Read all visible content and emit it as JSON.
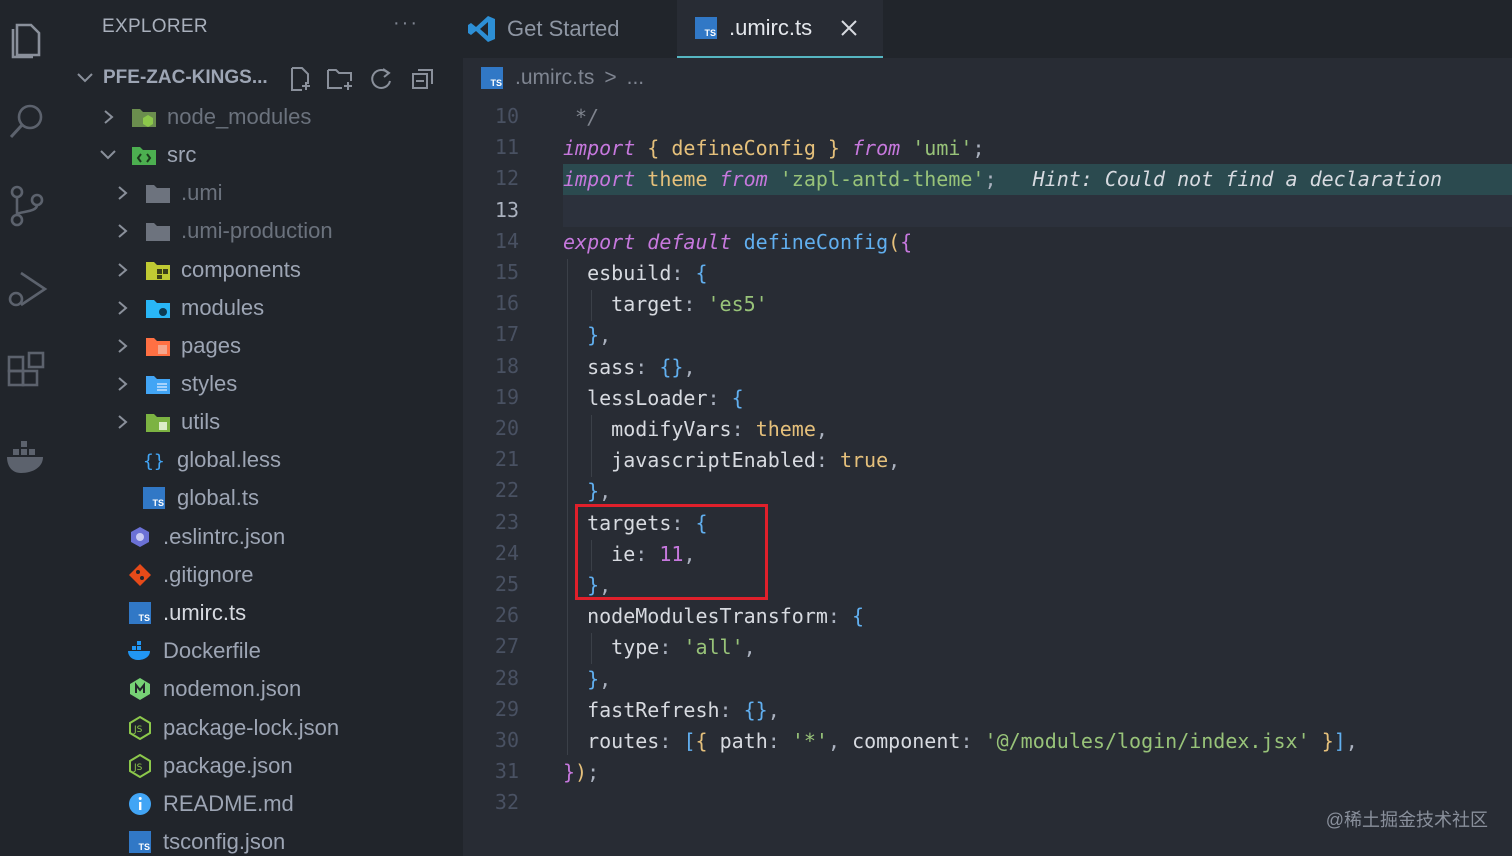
{
  "activity_bar": {
    "icons": [
      "files-icon",
      "search-icon",
      "source-control-icon",
      "run-debug-icon",
      "extensions-icon",
      "docker-icon"
    ]
  },
  "sidebar": {
    "title": "EXPLORER",
    "more": "···",
    "folder_name": "PFE-ZAC-KINGS...",
    "tree": [
      {
        "label": "node_modules",
        "dim": true
      },
      {
        "label": "src",
        "dim": false
      },
      {
        "label": ".umi",
        "dim": true
      },
      {
        "label": ".umi-production",
        "dim": true
      },
      {
        "label": "components",
        "dim": false
      },
      {
        "label": "modules",
        "dim": false
      },
      {
        "label": "pages",
        "dim": false
      },
      {
        "label": "styles",
        "dim": false
      },
      {
        "label": "utils",
        "dim": false
      },
      {
        "label": "global.less",
        "dim": false
      },
      {
        "label": "global.ts",
        "dim": false
      },
      {
        "label": ".eslintrc.json",
        "dim": false
      },
      {
        "label": ".gitignore",
        "dim": false
      },
      {
        "label": ".umirc.ts",
        "dim": false
      },
      {
        "label": "Dockerfile",
        "dim": false
      },
      {
        "label": "nodemon.json",
        "dim": false
      },
      {
        "label": "package-lock.json",
        "dim": false
      },
      {
        "label": "package.json",
        "dim": false
      },
      {
        "label": "README.md",
        "dim": false
      },
      {
        "label": "tsconfig.json",
        "dim": false
      }
    ]
  },
  "tabs": [
    {
      "label": "Get Started",
      "active": false
    },
    {
      "label": ".umirc.ts",
      "active": true
    }
  ],
  "breadcrumb": {
    "file": ".umirc.ts",
    "sep": ">",
    "rest": "..."
  },
  "line_numbers": [
    "10",
    "11",
    "12",
    "13",
    "14",
    "15",
    "16",
    "17",
    "18",
    "19",
    "20",
    "21",
    "22",
    "23",
    "24",
    "25",
    "26",
    "27",
    "28",
    "29",
    "30",
    "31",
    "32"
  ],
  "current_line": "13",
  "code": {
    "l10": " */",
    "l11_import": "import",
    "l11_body": " defineConfig ",
    "l11_from": "from",
    "l11_str": "'umi'",
    "l12_import": "import",
    "l12_theme": " theme ",
    "l12_from": "from",
    "l12_str": "'zapl-antd-theme'",
    "l12_hint": "Hint: Could not find a declaration",
    "l14_export": "export default",
    "l14_fn": "defineConfig",
    "l15": "esbuild",
    "l16_key": "target",
    "l16_val": "'es5'",
    "l18": "sass",
    "l19": "lessLoader",
    "l20_key": "modifyVars",
    "l20_val": "theme",
    "l21_key": "javascriptEnabled",
    "l21_val": "true",
    "l23": "targets",
    "l24_key": "ie",
    "l24_val": "11",
    "l26": "nodeModulesTransform",
    "l27_key": "type",
    "l27_val": "'all'",
    "l29": "fastRefresh",
    "l30_key": "routes",
    "l30_path_key": "path",
    "l30_path_val": "'*'",
    "l30_comp_key": "component",
    "l30_comp_val": "'@/modules/login/index.jsx'"
  },
  "watermark": "@稀土掘金技术社区"
}
